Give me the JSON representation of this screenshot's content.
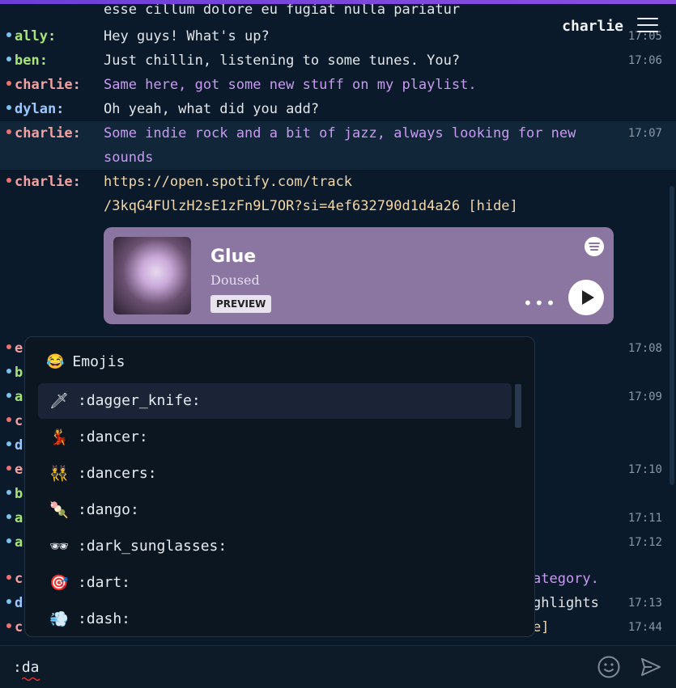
{
  "header": {
    "username": "charlie",
    "menu_icon": "hamburger-menu-icon"
  },
  "colors": {
    "accent": "#7a48e0",
    "embed_bg": "#8a76a0",
    "background": "#0b1a2a"
  },
  "messages": [
    {
      "nick": "",
      "text": "esse cillum dolore eu fugiat nulla pariatur",
      "time": "",
      "color": "green"
    },
    {
      "nick": "ally:",
      "text": "Hey guys! What's up?",
      "time": "17:05",
      "color": "green"
    },
    {
      "nick": "ben:",
      "text": "Just chillin, listening to some tunes. You?",
      "time": "17:06",
      "color": "green"
    },
    {
      "nick": "charlie:",
      "text": "Same here, got some new stuff on my playlist.",
      "time": "",
      "color": "red"
    },
    {
      "nick": "dylan:",
      "text": "Oh yeah, what did you add?",
      "time": "",
      "color": "blue"
    },
    {
      "nick": "charlie:",
      "text_line1": "Some indie rock and a bit of jazz, always looking for new",
      "text_line2": "sounds",
      "time": "17:07",
      "color": "red"
    },
    {
      "nick": "charlie:",
      "link_line1": "https://open.spotify.com/track",
      "link_line2": "/3kqG4FUlzH2sE1zFn9L7OR?si=4ef632790d1d4a26",
      "hide_label": "[hide]",
      "time": "",
      "color": "red"
    }
  ],
  "embed": {
    "title": "Glue",
    "artist": "Doused",
    "preview_label": "PREVIEW",
    "more_label": "•••",
    "icons": [
      "spotify-icon",
      "play-icon",
      "more-icon"
    ]
  },
  "hidden_rows": [
    {
      "nick": "e",
      "time": "17:08",
      "color": "red"
    },
    {
      "nick": "b",
      "time": "",
      "color": "green"
    },
    {
      "nick": "a",
      "time": "17:09",
      "color": "green"
    },
    {
      "nick": "c",
      "time": "",
      "color": "red"
    },
    {
      "nick": "d",
      "time": "",
      "color": "blue"
    },
    {
      "nick": "e",
      "time": "17:10",
      "color": "red"
    },
    {
      "nick": "b",
      "time": "",
      "color": "green"
    },
    {
      "nick": "a",
      "time": "17:11",
      "color": "green"
    },
    {
      "nick": "a",
      "time": "17:12",
      "color": "green"
    },
    {
      "nick": "c",
      "tail": "ategory.",
      "time": "",
      "color": "red"
    },
    {
      "nick": "d",
      "tail": "ghlights",
      "time": "17:13",
      "color": "blue"
    },
    {
      "nick": "c",
      "tail": "e]",
      "time": "17:44",
      "color": "red"
    }
  ],
  "emoji_popup": {
    "header_icon": "😂",
    "header": "Emojis",
    "options": [
      {
        "icon": "🗡",
        "label": ":dagger_knife:",
        "selected": true
      },
      {
        "icon": "💃",
        "label": ":dancer:"
      },
      {
        "icon": "👯",
        "label": ":dancers:"
      },
      {
        "icon": "🍡",
        "label": ":dango:"
      },
      {
        "icon": "🕶",
        "label": ":dark_sunglasses:"
      },
      {
        "icon": "🎯",
        "label": ":dart:"
      },
      {
        "icon": "💨",
        "label": ":dash:"
      }
    ]
  },
  "input": {
    "value": ":da",
    "emoji_button": "smiley-icon",
    "send_button": "send-icon"
  }
}
